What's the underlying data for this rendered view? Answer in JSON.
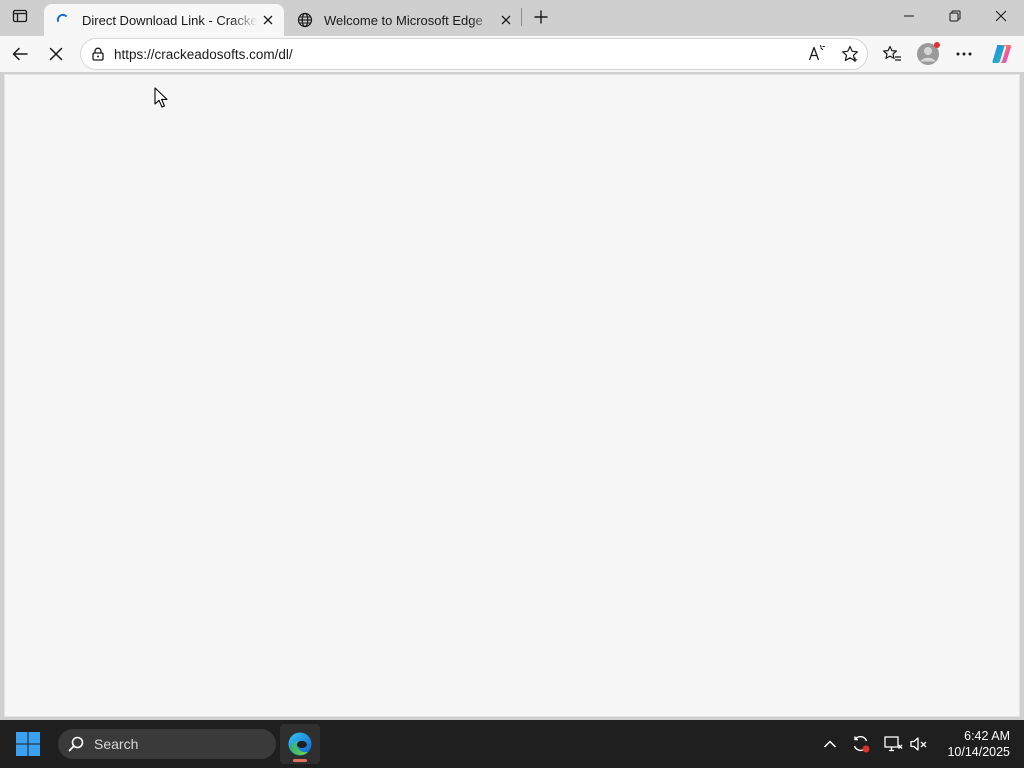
{
  "browser": {
    "tabs": [
      {
        "title": "Direct Download Link - Crackeados",
        "favicon": "loading-spinner-icon",
        "active": true
      },
      {
        "title": "Welcome to Microsoft Edge",
        "favicon": "globe-icon",
        "active": false
      }
    ],
    "address": {
      "url": "https://crackeadosofts.com/dl/"
    },
    "colors": {
      "tab_strip": "#cfcfcf",
      "toolbar": "#f7f7f7",
      "content": "#f6f6f6",
      "profile_badge": "#e0312a"
    }
  },
  "taskbar": {
    "search_label": "Search",
    "clock": {
      "time": "6:42 AM",
      "date": "10/14/2025"
    },
    "colors": {
      "background": "#1f1f1f",
      "start_blue": "#3aa0f0",
      "running_indicator": "#e0705a"
    }
  }
}
